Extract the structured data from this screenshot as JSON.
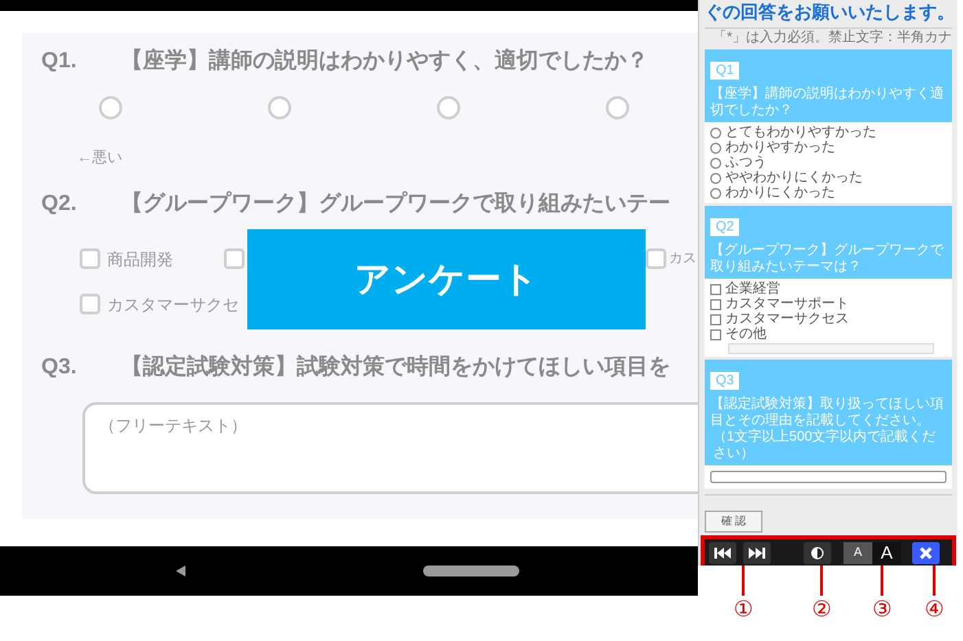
{
  "form": {
    "questions": [
      {
        "kind": "scale",
        "number": "Q1.",
        "title": "【座学】講師の説明はわかりやすく、適切でしたか？",
        "options": [
          {
            "selected": false
          },
          {
            "selected": false
          },
          {
            "selected": false
          },
          {
            "selected": false
          }
        ],
        "scale_label": "←悪い"
      },
      {
        "kind": "checkboxes",
        "number": "Q2.",
        "title": "【グループワーク】グループワークで取り組みたいテー",
        "rows": [
          [
            {
              "label": "商品開発",
              "checked": false
            },
            {
              "checked": false
            },
            {
              "label": "カス",
              "checked": false
            }
          ],
          [
            {
              "label": "カスタマーサクセ",
              "checked": false
            }
          ]
        ]
      },
      {
        "kind": "text",
        "number": "Q3.",
        "title": "【認定試験対策】試験対策で時間をかけてほしい項目を",
        "placeholder": "（フリーテキスト）"
      }
    ]
  },
  "banner": {
    "title": "アンケート"
  },
  "panel": {
    "heading": "ぐの回答をお願いいたします。",
    "note": "「*」は入力必須。禁止文字：半角カナ",
    "questions": [
      {
        "kind": "radio",
        "badge": "Q1",
        "title": "【座学】講師の説明はわかりやすく適切でしたか？",
        "options": [
          {
            "label": "とてもわかりやすかった",
            "selected": false
          },
          {
            "label": "わかりやすかった",
            "selected": false
          },
          {
            "label": "ふつう",
            "selected": false
          },
          {
            "label": "ややわかりにくかった",
            "selected": false
          },
          {
            "label": "わかりにくかった",
            "selected": false
          }
        ]
      },
      {
        "kind": "checkbox",
        "badge": "Q2",
        "title": "【グループワーク】グループワークで取り組みたいテーマは？",
        "options": [
          {
            "label": "企業経営",
            "checked": false,
            "has_field": false
          },
          {
            "label": "カスタマーサポート",
            "checked": false,
            "has_field": false
          },
          {
            "label": "カスタマーサクセス",
            "checked": false,
            "has_field": false
          },
          {
            "label": "その他",
            "checked": false,
            "has_field": true
          }
        ]
      },
      {
        "kind": "text",
        "badge": "Q3",
        "title": "【認定試験対策】取り扱ってほしい項目とその理由を記載してください。",
        "note": "（1文字以上500文字以内で記載ください）"
      }
    ],
    "confirm_button": "確 認"
  },
  "toolbar": {
    "buttons": [
      {
        "kind": "prev"
      },
      {
        "kind": "next"
      },
      {
        "kind": "contrast"
      },
      {
        "kind": "font_small",
        "label": "A",
        "selected": false
      },
      {
        "kind": "font_large",
        "label": "A",
        "selected": true
      },
      {
        "kind": "close"
      }
    ]
  },
  "callouts": [
    "①",
    "②",
    "③",
    "④"
  ]
}
